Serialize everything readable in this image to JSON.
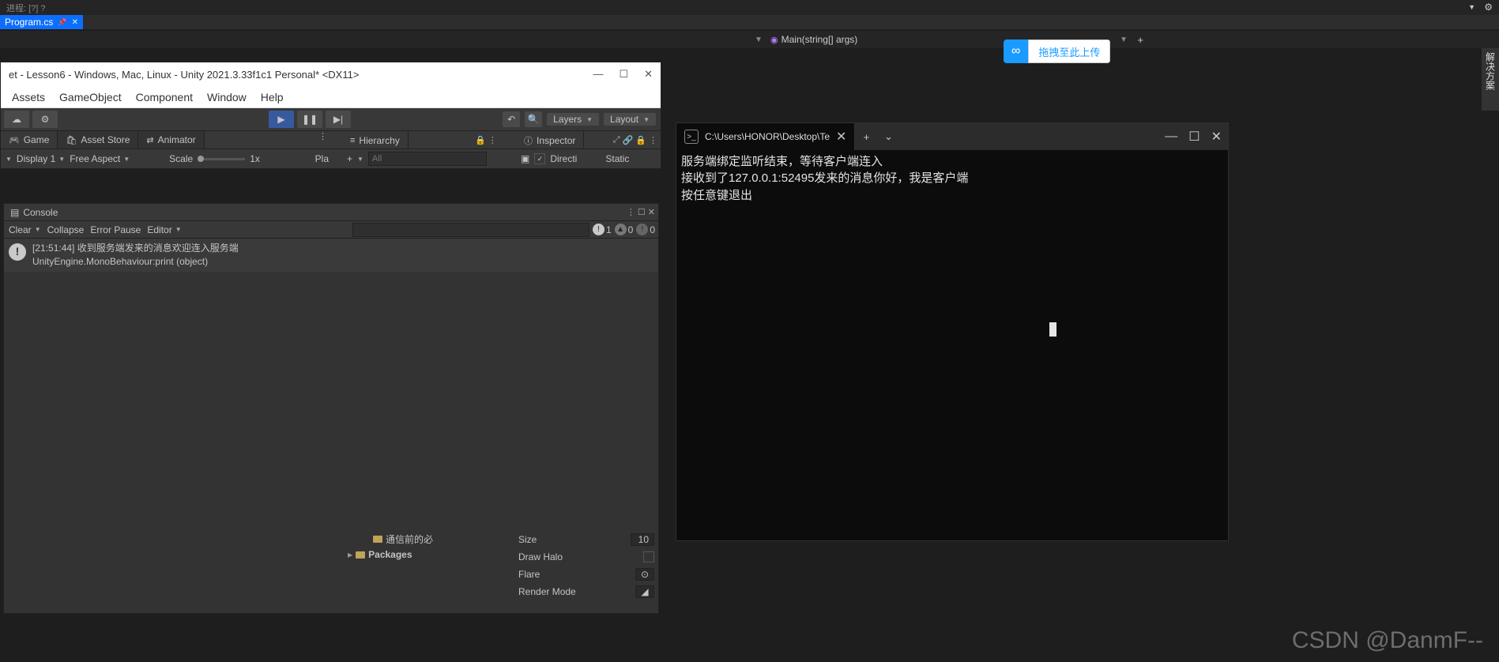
{
  "top": {
    "label_process": "进程: [?] ?",
    "gear": "⚙",
    "tri": "▼"
  },
  "vtab": {
    "label": "解决方案"
  },
  "file_tab": {
    "name": "Program.cs",
    "pin": "📌",
    "x": "✕"
  },
  "breadcrumb": {
    "method": "Main(string[] args)",
    "dd": "▼"
  },
  "upload": {
    "icon": "∞",
    "label": "拖拽至此上传"
  },
  "unity": {
    "title": "et - Lesson6 - Windows, Mac, Linux - Unity 2021.3.33f1c1 Personal* <DX11>",
    "minimize": "—",
    "maximize": "☐",
    "close": "✕",
    "menu": {
      "assets": "Assets",
      "gameobject": "GameObject",
      "component": "Component",
      "window": "Window",
      "help": "Help"
    },
    "toolbar": {
      "cloud": "☁",
      "gear": "⚙",
      "play": "▶",
      "pause": "❚❚",
      "step": "▶|",
      "undo": "↶",
      "search": "🔍",
      "layers": "Layers",
      "layout": "Layout"
    },
    "tabs": {
      "game": "Game",
      "assetstore": "Asset Store",
      "animator": "Animator",
      "hierarchy": "Hierarchy",
      "inspector": "Inspector"
    },
    "subbar": {
      "display": "Display 1",
      "aspect": "Free Aspect",
      "scale": "Scale",
      "scale_val": "1x",
      "pla": "Pla",
      "plus": "+",
      "all": "All",
      "check": "✓",
      "directic": "Directi",
      "static": "Static"
    },
    "console": {
      "tab": "Console",
      "clear": "Clear",
      "collapse": "Collapse",
      "errorpause": "Error Pause",
      "editor": "Editor",
      "info": "1",
      "warn": "0",
      "err": "0",
      "log_line1": "[21:51:44] 收到服务端发来的消息欢迎连入服务端",
      "log_line2": "UnityEngine.MonoBehaviour:print (object)"
    },
    "hier_rem": {
      "row1": "通信前的必",
      "packages": "Packages"
    },
    "insp_rem": {
      "size": "Size",
      "size_val": "10",
      "drawhalo": "Draw Halo",
      "flare": "Flare",
      "flare_ico": "⊙",
      "rendermode": "Render Mode",
      "rm_ico": "◢"
    }
  },
  "terminal": {
    "tab_icon": ">_",
    "tab_title": "C:\\Users\\HONOR\\Desktop\\Te",
    "tab_x": "✕",
    "plus": "+",
    "chev": "⌄",
    "min": "—",
    "max": "☐",
    "close": "✕",
    "line1": "服务端绑定监听结束，等待客户端连入",
    "line2": "接收到了127.0.0.1:52495发来的消息你好，我是客户端",
    "line3": "按任意键退出"
  },
  "watermark": "CSDN @DanmF--"
}
